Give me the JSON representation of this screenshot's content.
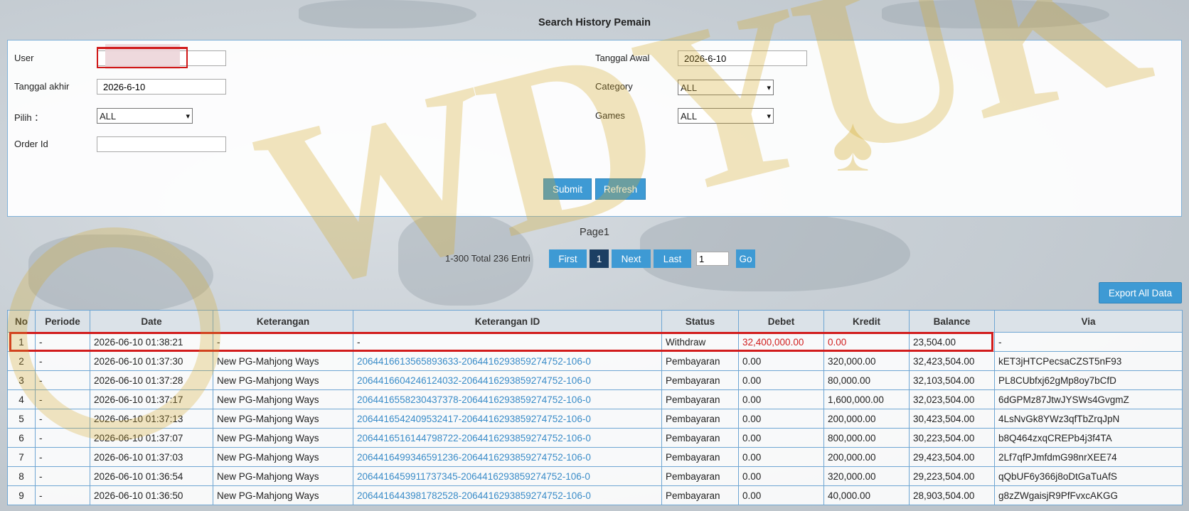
{
  "page_title": "Search History Pemain",
  "form": {
    "user_label": "User",
    "user_value": "",
    "tanggal_awal_label": "Tanggal Awal",
    "tanggal_awal_value": "2026-6-10",
    "tanggal_akhir_label": "Tanggal akhir",
    "tanggal_akhir_value": "2026-6-10",
    "category_label": "Category",
    "category_value": "ALL",
    "pilih_label": "Pilih ：",
    "pilih_value": "ALL",
    "games_label": "Games",
    "games_value": "ALL",
    "order_id_label": "Order Id",
    "order_id_value": "",
    "submit_label": "Submit",
    "refresh_label": "Refresh"
  },
  "pagination": {
    "page_label": "Page1",
    "total_text": "1-300 Total 236 Entri",
    "first_label": "First",
    "current_page": "1",
    "next_label": "Next",
    "last_label": "Last",
    "page_input_value": "1",
    "go_label": "Go"
  },
  "export_label": "Export All Data",
  "table": {
    "columns": [
      "No",
      "Periode",
      "Date",
      "Keterangan",
      "Keterangan ID",
      "Status",
      "Debet",
      "Kredit",
      "Balance",
      "Via"
    ],
    "rows": [
      {
        "no": "1",
        "periode": "-",
        "date": "2026-06-10 01:38:21",
        "keterangan": "-",
        "keterangan_id": "-",
        "status": "Withdraw",
        "debet": "32,400,000.00",
        "kredit": "0.00",
        "balance": "23,504.00",
        "via": "-"
      },
      {
        "no": "2",
        "periode": "-",
        "date": "2026-06-10 01:37:30",
        "keterangan": "New PG-Mahjong Ways",
        "keterangan_id": "2064416613565893633-2064416293859274752-106-0",
        "status": "Pembayaran",
        "debet": "0.00",
        "kredit": "320,000.00",
        "balance": "32,423,504.00",
        "via": "kET3jHTCPecsaCZST5nF93"
      },
      {
        "no": "3",
        "periode": "-",
        "date": "2026-06-10 01:37:28",
        "keterangan": "New PG-Mahjong Ways",
        "keterangan_id": "2064416604246124032-2064416293859274752-106-0",
        "status": "Pembayaran",
        "debet": "0.00",
        "kredit": "80,000.00",
        "balance": "32,103,504.00",
        "via": "PL8CUbfxj62gMp8oy7bCfD"
      },
      {
        "no": "4",
        "periode": "-",
        "date": "2026-06-10 01:37:17",
        "keterangan": "New PG-Mahjong Ways",
        "keterangan_id": "2064416558230437378-2064416293859274752-106-0",
        "status": "Pembayaran",
        "debet": "0.00",
        "kredit": "1,600,000.00",
        "balance": "32,023,504.00",
        "via": "6dGPMz87JtwJYSWs4GvgmZ"
      },
      {
        "no": "5",
        "periode": "-",
        "date": "2026-06-10 01:37:13",
        "keterangan": "New PG-Mahjong Ways",
        "keterangan_id": "2064416542409532417-2064416293859274752-106-0",
        "status": "Pembayaran",
        "debet": "0.00",
        "kredit": "200,000.00",
        "balance": "30,423,504.00",
        "via": "4LsNvGk8YWz3qfTbZrqJpN"
      },
      {
        "no": "6",
        "periode": "-",
        "date": "2026-06-10 01:37:07",
        "keterangan": "New PG-Mahjong Ways",
        "keterangan_id": "2064416516144798722-2064416293859274752-106-0",
        "status": "Pembayaran",
        "debet": "0.00",
        "kredit": "800,000.00",
        "balance": "30,223,504.00",
        "via": "b8Q464zxqCREPb4j3f4TA"
      },
      {
        "no": "7",
        "periode": "-",
        "date": "2026-06-10 01:37:03",
        "keterangan": "New PG-Mahjong Ways",
        "keterangan_id": "2064416499346591236-2064416293859274752-106-0",
        "status": "Pembayaran",
        "debet": "0.00",
        "kredit": "200,000.00",
        "balance": "29,423,504.00",
        "via": "2Lf7qfPJmfdmG98nrXEE74"
      },
      {
        "no": "8",
        "periode": "-",
        "date": "2026-06-10 01:36:54",
        "keterangan": "New PG-Mahjong Ways",
        "keterangan_id": "2064416459911737345-2064416293859274752-106-0",
        "status": "Pembayaran",
        "debet": "0.00",
        "kredit": "320,000.00",
        "balance": "29,223,504.00",
        "via": "qQbUF6y366j8oDtGaTuAfS"
      },
      {
        "no": "9",
        "periode": "-",
        "date": "2026-06-10 01:36:50",
        "keterangan": "New PG-Mahjong Ways",
        "keterangan_id": "2064416443981782528-2064416293859274752-106-0",
        "status": "Pembayaran",
        "debet": "0.00",
        "kredit": "40,000.00",
        "balance": "28,903,504.00",
        "via": "g8zZWgaisjR9PfFvxcAKGG"
      }
    ]
  },
  "watermark_text": "WDYUK",
  "colors": {
    "accent": "#3e9ad4",
    "active_page": "#1c3f63",
    "highlight": "#d21c1c",
    "link": "#3a8cc8"
  }
}
